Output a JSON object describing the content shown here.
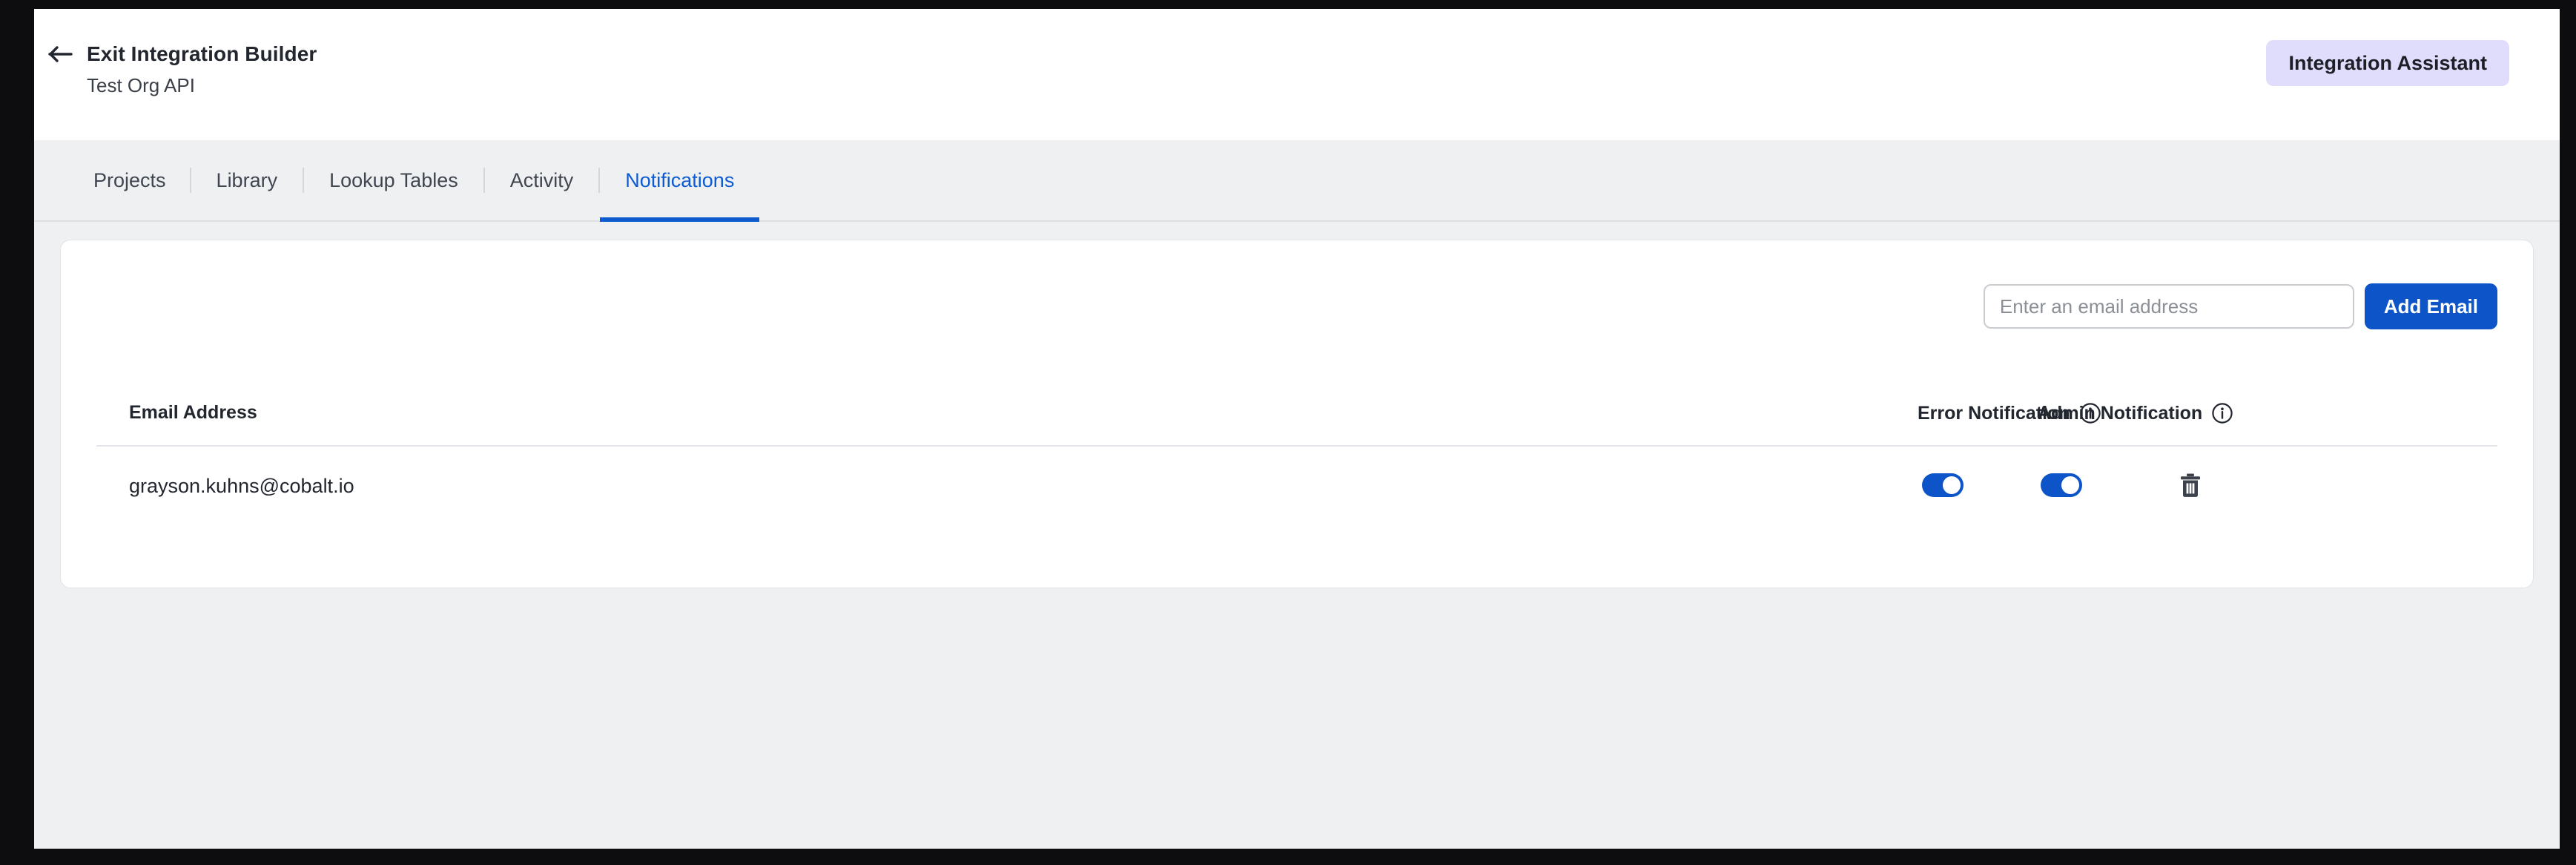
{
  "header": {
    "back_icon": "arrow-left-icon",
    "exit_label": "Exit Integration Builder",
    "org_name": "Test Org API",
    "assistant_button": "Integration Assistant",
    "assistant_bg": "#e0dcfc"
  },
  "tabs": [
    {
      "label": "Projects",
      "active": false
    },
    {
      "label": "Library",
      "active": false
    },
    {
      "label": "Lookup Tables",
      "active": false
    },
    {
      "label": "Activity",
      "active": false
    },
    {
      "label": "Notifications",
      "active": true
    }
  ],
  "colors": {
    "accent_blue": "#0d54c8",
    "active_tab_blue": "#0d5bd1",
    "page_bg": "#eff0f2",
    "card_bg": "#ffffff",
    "toggle_on": "#0d54c8",
    "trash_icon": "#3c414b"
  },
  "add_email": {
    "placeholder": "Enter an email address",
    "value": "",
    "button_label": "Add Email"
  },
  "table": {
    "columns": [
      {
        "key": "email",
        "label": "Email Address",
        "info": false
      },
      {
        "key": "error",
        "label": "Error Notification",
        "info": true,
        "info_icon": "info-circle-icon"
      },
      {
        "key": "admin",
        "label": "Admin Notification",
        "info": true,
        "info_icon": "info-circle-icon"
      }
    ],
    "rows": [
      {
        "email": "grayson.kuhns@cobalt.io",
        "error_notification": true,
        "admin_notification": true,
        "delete_icon": "trash-icon"
      }
    ]
  }
}
